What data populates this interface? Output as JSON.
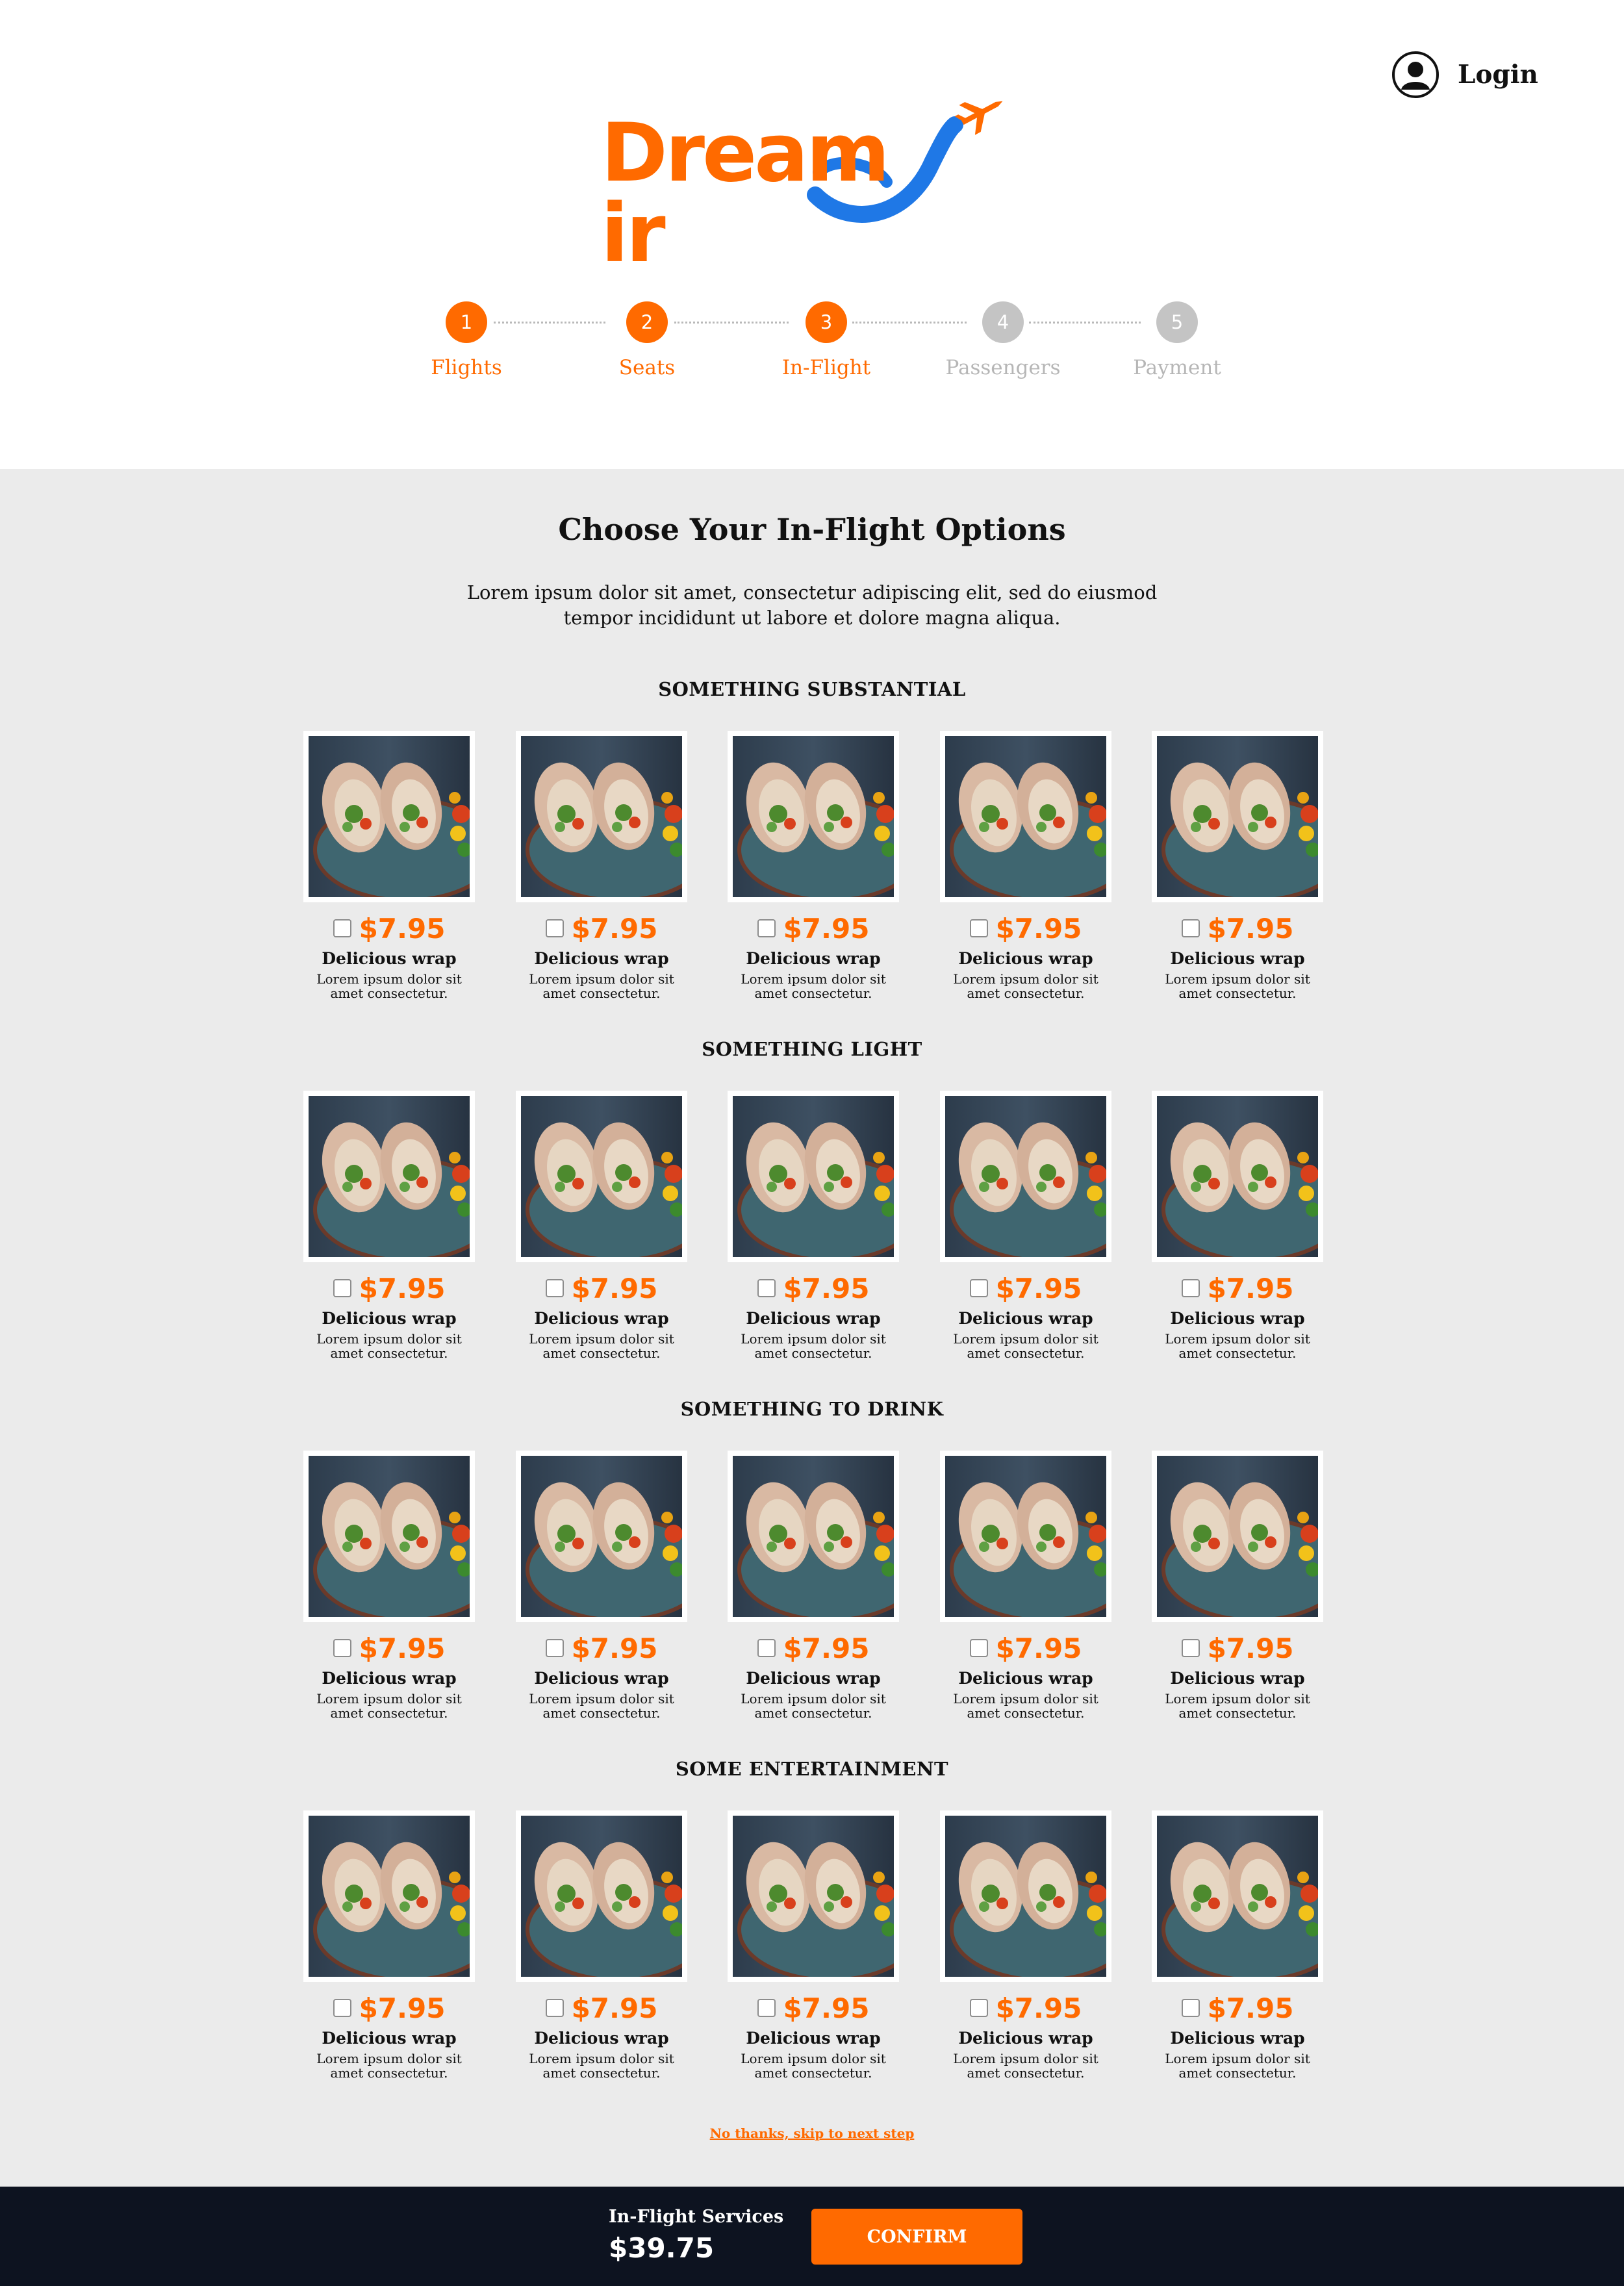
{
  "brand": {
    "name": "Dream",
    "name_tail": "ir",
    "primary_color": "#ff6a00",
    "secondary_color": "#1f78e6"
  },
  "header": {
    "login_label": "Login"
  },
  "stepper": {
    "steps": [
      {
        "number": "1",
        "label": "Flights",
        "state": "done"
      },
      {
        "number": "2",
        "label": "Seats",
        "state": "done"
      },
      {
        "number": "3",
        "label": "In-Flight",
        "state": "current"
      },
      {
        "number": "4",
        "label": "Passengers",
        "state": "todo"
      },
      {
        "number": "5",
        "label": "Payment",
        "state": "todo"
      }
    ]
  },
  "main": {
    "title": "Choose Your In-Flight Options",
    "intro": "Lorem ipsum dolor sit amet, consectetur adipiscing elit, sed do eiusmod tempor incididunt ut labore et dolore magna aliqua.",
    "sections": [
      {
        "title": "SOMETHING SUBSTANTIAL",
        "items": [
          {
            "price": "$7.95",
            "name": "Delicious wrap",
            "desc": "Lorem ipsum dolor sit amet consectetur.",
            "checked": false
          },
          {
            "price": "$7.95",
            "name": "Delicious wrap",
            "desc": "Lorem ipsum dolor sit amet consectetur.",
            "checked": false
          },
          {
            "price": "$7.95",
            "name": "Delicious wrap",
            "desc": "Lorem ipsum dolor sit amet consectetur.",
            "checked": false
          },
          {
            "price": "$7.95",
            "name": "Delicious wrap",
            "desc": "Lorem ipsum dolor sit amet consectetur.",
            "checked": false
          },
          {
            "price": "$7.95",
            "name": "Delicious wrap",
            "desc": "Lorem ipsum dolor sit amet consectetur.",
            "checked": false
          }
        ]
      },
      {
        "title": "SOMETHING LIGHT",
        "items": [
          {
            "price": "$7.95",
            "name": "Delicious wrap",
            "desc": "Lorem ipsum dolor sit amet consectetur.",
            "checked": false
          },
          {
            "price": "$7.95",
            "name": "Delicious wrap",
            "desc": "Lorem ipsum dolor sit amet consectetur.",
            "checked": false
          },
          {
            "price": "$7.95",
            "name": "Delicious wrap",
            "desc": "Lorem ipsum dolor sit amet consectetur.",
            "checked": false
          },
          {
            "price": "$7.95",
            "name": "Delicious wrap",
            "desc": "Lorem ipsum dolor sit amet consectetur.",
            "checked": false
          },
          {
            "price": "$7.95",
            "name": "Delicious wrap",
            "desc": "Lorem ipsum dolor sit amet consectetur.",
            "checked": false
          }
        ]
      },
      {
        "title": "SOMETHING TO DRINK",
        "items": [
          {
            "price": "$7.95",
            "name": "Delicious wrap",
            "desc": "Lorem ipsum dolor sit amet consectetur.",
            "checked": false
          },
          {
            "price": "$7.95",
            "name": "Delicious wrap",
            "desc": "Lorem ipsum dolor sit amet consectetur.",
            "checked": false
          },
          {
            "price": "$7.95",
            "name": "Delicious wrap",
            "desc": "Lorem ipsum dolor sit amet consectetur.",
            "checked": false
          },
          {
            "price": "$7.95",
            "name": "Delicious wrap",
            "desc": "Lorem ipsum dolor sit amet consectetur.",
            "checked": false
          },
          {
            "price": "$7.95",
            "name": "Delicious wrap",
            "desc": "Lorem ipsum dolor sit amet consectetur.",
            "checked": false
          }
        ]
      },
      {
        "title": "SOME ENTERTAINMENT",
        "items": [
          {
            "price": "$7.95",
            "name": "Delicious wrap",
            "desc": "Lorem ipsum dolor sit amet consectetur.",
            "checked": false
          },
          {
            "price": "$7.95",
            "name": "Delicious wrap",
            "desc": "Lorem ipsum dolor sit amet consectetur.",
            "checked": false
          },
          {
            "price": "$7.95",
            "name": "Delicious wrap",
            "desc": "Lorem ipsum dolor sit amet consectetur.",
            "checked": false
          },
          {
            "price": "$7.95",
            "name": "Delicious wrap",
            "desc": "Lorem ipsum dolor sit amet consectetur.",
            "checked": false
          },
          {
            "price": "$7.95",
            "name": "Delicious wrap",
            "desc": "Lorem ipsum dolor sit amet consectetur.",
            "checked": false
          }
        ]
      }
    ],
    "skip_link": "No thanks, skip to next step"
  },
  "footer": {
    "services_label": "In-Flight Services",
    "services_total": "$39.75",
    "confirm_label": "CONFIRM"
  }
}
